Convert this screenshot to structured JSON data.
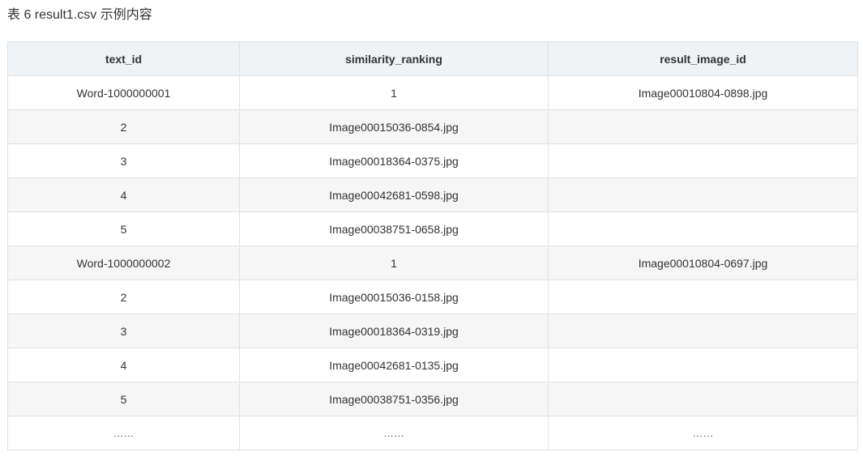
{
  "caption": "表 6 result1.csv 示例内容",
  "table": {
    "headers": [
      "text_id",
      "similarity_ranking",
      "result_image_id"
    ],
    "rows": [
      [
        "Word-1000000001",
        "1",
        "Image00010804-0898.jpg"
      ],
      [
        "2",
        "Image00015036-0854.jpg",
        ""
      ],
      [
        "3",
        "Image00018364-0375.jpg",
        ""
      ],
      [
        "4",
        "Image00042681-0598.jpg",
        ""
      ],
      [
        "5",
        "Image00038751-0658.jpg",
        ""
      ],
      [
        "Word-1000000002",
        "1",
        "Image00010804-0697.jpg"
      ],
      [
        "2",
        "Image00015036-0158.jpg",
        ""
      ],
      [
        "3",
        "Image00018364-0319.jpg",
        ""
      ],
      [
        "4",
        "Image00042681-0135.jpg",
        ""
      ],
      [
        "5",
        "Image00038751-0356.jpg",
        ""
      ],
      [
        "……",
        "……",
        "……"
      ]
    ]
  }
}
